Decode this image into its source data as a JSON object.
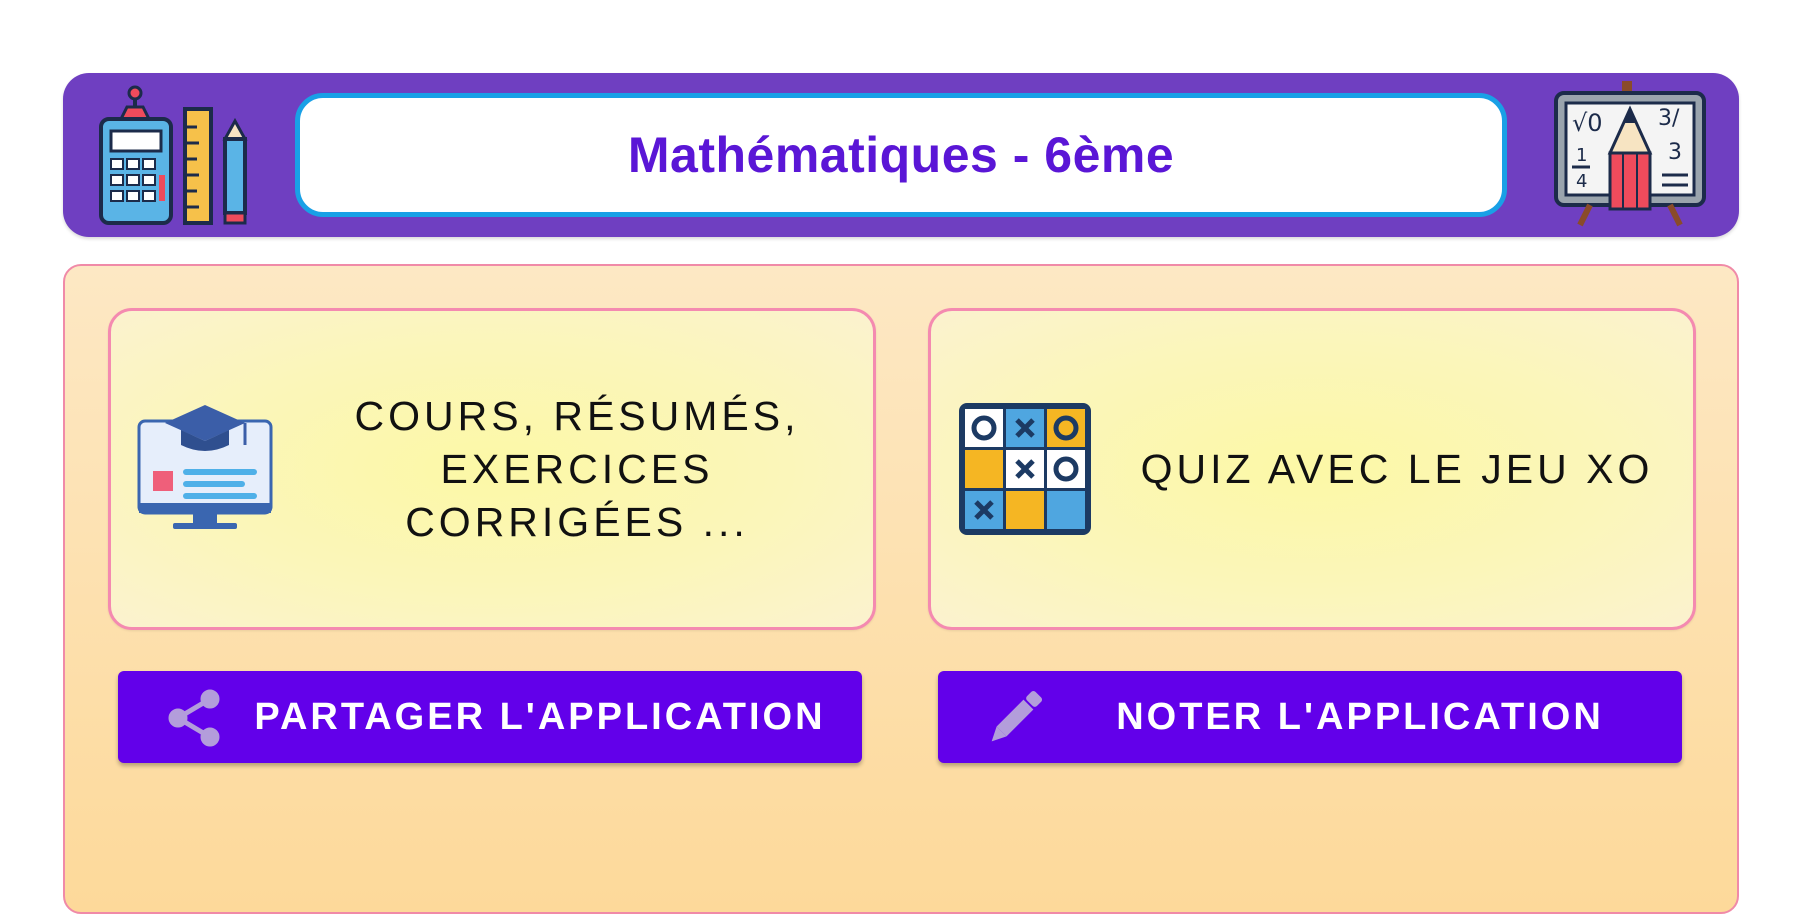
{
  "header": {
    "title": "Mathématiques - 6ème",
    "left_icon": "calculator-ruler-pencil-icon",
    "right_icon": "math-board-pencil-icon",
    "background_color": "#6f3fc1",
    "title_color": "#5a16d6",
    "title_border_color": "#19a0e6"
  },
  "cards": [
    {
      "label": "COURS, RÉSUMÉS, EXERCICES CORRIGÉES ...",
      "icon": "graduation-monitor-icon"
    },
    {
      "label": "QUIZ AVEC LE JEU XO",
      "icon": "tic-tac-toe-icon"
    }
  ],
  "buttons": {
    "share": {
      "label": "PARTAGER L'APPLICATION",
      "icon": "share-icon"
    },
    "rate": {
      "label": "NOTER L'APPLICATION",
      "icon": "pencil-icon"
    },
    "color": "#6200ea"
  },
  "panel": {
    "border_color": "#f08aa8",
    "background_top": "#fde8c4",
    "background_bottom": "#fdd99a"
  }
}
